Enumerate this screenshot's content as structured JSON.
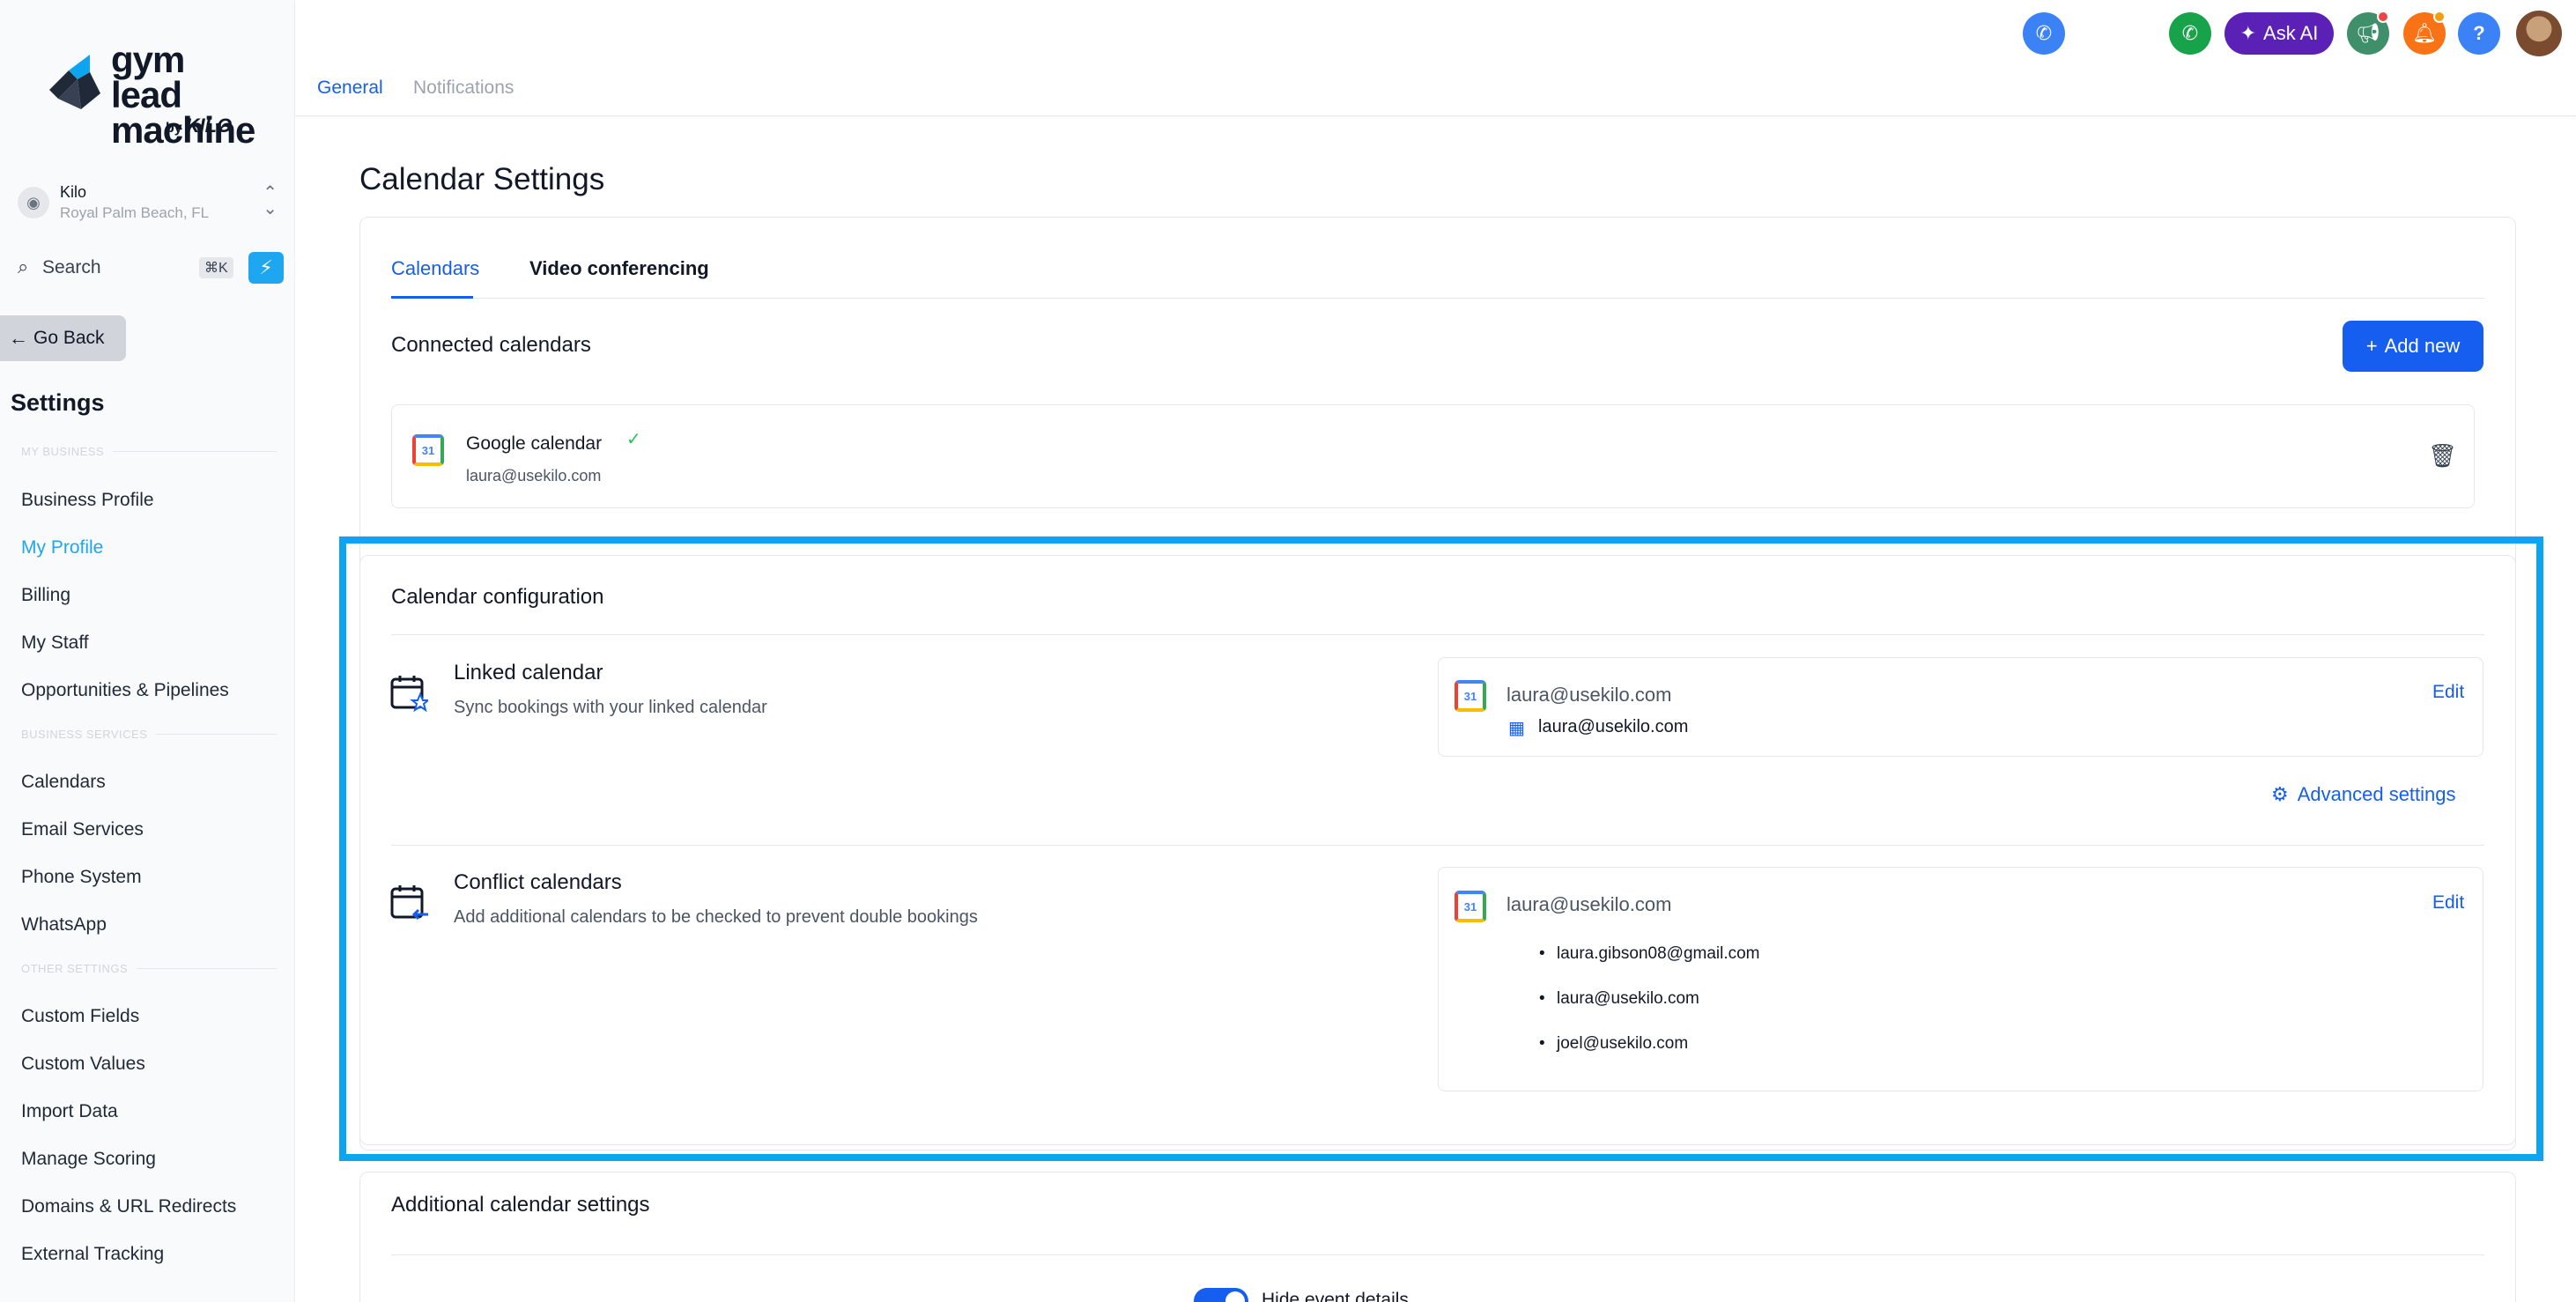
{
  "brand": {
    "line1": "gym lead",
    "line2": "machine",
    "by": "by",
    "kilo": "KILO"
  },
  "location": {
    "name": "Kilo",
    "address": "Royal Palm Beach, FL"
  },
  "search": {
    "label": "Search",
    "shortcut": "⌘K"
  },
  "sidebar": {
    "go_back": "Go Back",
    "title": "Settings",
    "sections": {
      "my_business": "MY BUSINESS",
      "business_services": "BUSINESS SERVICES",
      "other_settings": "OTHER SETTINGS"
    },
    "items": [
      "Business Profile",
      "My Profile",
      "Billing",
      "My Staff",
      "Opportunities & Pipelines",
      "Calendars",
      "Email Services",
      "Phone System",
      "WhatsApp",
      "Custom Fields",
      "Custom Values",
      "Import Data",
      "Manage Scoring",
      "Domains & URL Redirects",
      "External Tracking"
    ]
  },
  "topbar": {
    "tabs": [
      "General",
      "Notifications"
    ],
    "ask_ai": "Ask AI"
  },
  "page": {
    "title": "Calendar Settings",
    "tabs": [
      "Calendars",
      "Video conferencing"
    ],
    "connected": {
      "heading": "Connected calendars",
      "add_new": "Add new",
      "calendar_name": "Google calendar",
      "calendar_email": "laura@usekilo.com"
    },
    "config": {
      "heading": "Calendar configuration",
      "linked": {
        "title": "Linked calendar",
        "subtitle": "Sync bookings with your linked calendar",
        "account": "laura@usekilo.com",
        "calendar": "laura@usekilo.com",
        "edit": "Edit"
      },
      "advanced": "Advanced settings",
      "conflict": {
        "title": "Conflict calendars",
        "subtitle": "Add additional calendars to be checked to prevent double bookings",
        "account": "laura@usekilo.com",
        "edit": "Edit",
        "calendars": [
          "laura.gibson08@gmail.com",
          "laura@usekilo.com",
          "joel@usekilo.com"
        ]
      }
    },
    "additional": {
      "heading": "Additional calendar settings",
      "toggle_label": "Hide event details"
    }
  },
  "colors": {
    "accent": "#155eef",
    "highlight": "#0ea5f0",
    "active_nav": "#1ea7f0"
  }
}
